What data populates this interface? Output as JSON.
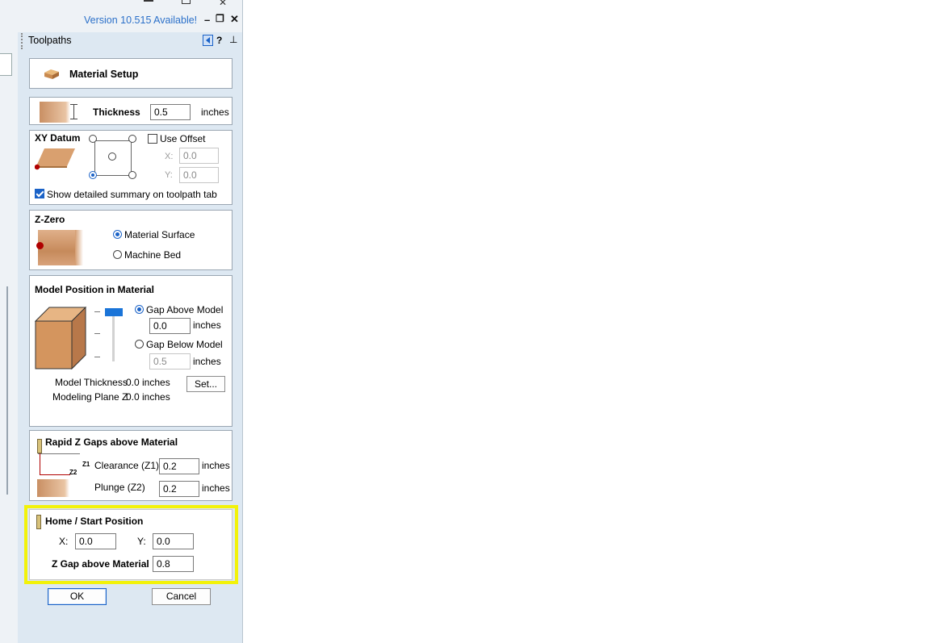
{
  "window": {
    "version_notice": "Version 10.515 Available!",
    "minimize_glyph": "–",
    "restore_glyph": "❐",
    "close_glyph": "✕"
  },
  "toolbar": {
    "title": "Toolpaths",
    "help_glyph": "?",
    "pin_glyph": "⊥"
  },
  "material_setup": {
    "title": "Material Setup"
  },
  "thickness": {
    "label": "Thickness",
    "value": "0.5",
    "unit": "inches"
  },
  "xy_datum": {
    "title": "XY Datum",
    "use_offset_label": "Use Offset",
    "use_offset_checked": false,
    "x_label": "X:",
    "x_value": "0.0",
    "y_label": "Y:",
    "y_value": "0.0",
    "summary_label": "Show detailed summary on toolpath tab",
    "summary_checked": true
  },
  "z_zero": {
    "title": "Z-Zero",
    "options": [
      "Material Surface",
      "Machine Bed"
    ],
    "selected": "Material Surface"
  },
  "model_position": {
    "title": "Model Position in Material",
    "gap_above_label": "Gap Above Model",
    "gap_above_value": "0.0",
    "gap_above_unit": "inches",
    "gap_below_label": "Gap Below Model",
    "gap_below_value": "0.5",
    "gap_below_unit": "inches",
    "model_thickness_label": "Model Thickness",
    "model_thickness_value": "0.0 inches",
    "modeling_plane_label": "Modeling Plane Z",
    "modeling_plane_value": "0.0 inches",
    "set_button": "Set..."
  },
  "rapid_z": {
    "title": "Rapid Z Gaps above Material",
    "z1_tag": "Z1",
    "z2_tag": "Z2",
    "clearance_label": "Clearance (Z1)",
    "clearance_value": "0.2",
    "clearance_unit": "inches",
    "plunge_label": "Plunge (Z2)",
    "plunge_value": "0.2",
    "plunge_unit": "inches"
  },
  "home": {
    "title": "Home / Start Position",
    "x_label": "X:",
    "x_value": "0.0",
    "y_label": "Y:",
    "y_value": "0.0",
    "zgap_label": "Z Gap above Material",
    "zgap_value": "0.8"
  },
  "buttons": {
    "ok": "OK",
    "cancel": "Cancel"
  },
  "colors": {
    "accent": "#1a62c7",
    "highlight": "#f2f20a",
    "material": "#d4955e",
    "version_link": "#2b70c9"
  }
}
